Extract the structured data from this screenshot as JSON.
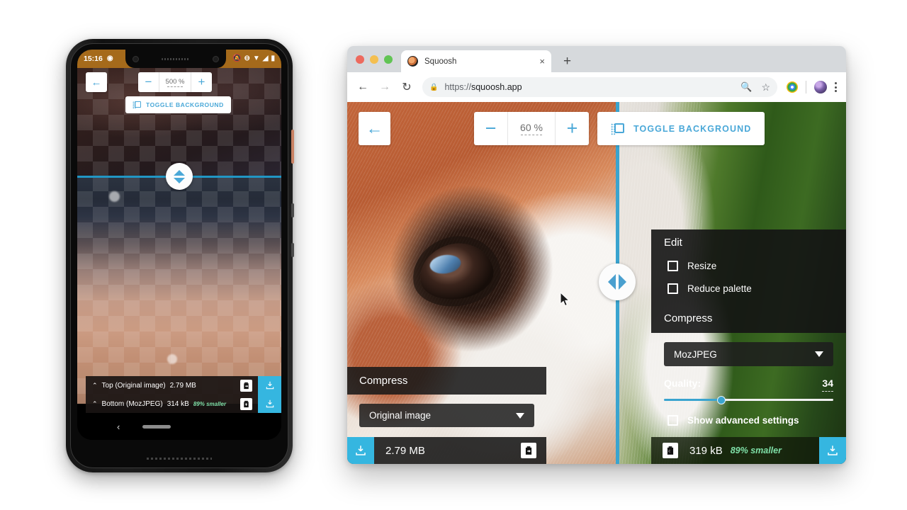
{
  "phone": {
    "status_bar": {
      "time": "15:16",
      "left_icon": "pocket-casts-icon",
      "right_icons": [
        "notifications-muted-icon",
        "do-not-disturb-icon",
        "wifi-icon",
        "cellular-signal-icon",
        "battery-icon"
      ]
    },
    "toolbar": {
      "back_label": "←",
      "zoom_minus": "−",
      "zoom_value": "500 %",
      "zoom_plus": "+",
      "toggle_background_label": "TOGGLE BACKGROUND"
    },
    "bars": [
      {
        "caret": "⌃",
        "label": "Top (Original image)",
        "size": "2.79 MB",
        "smaller": "",
        "copy_icon": "copy-to-other-side-icon",
        "download_icon": "download-icon"
      },
      {
        "caret": "⌃",
        "label": "Bottom (MozJPEG)",
        "size": "314 kB",
        "smaller": "89% smaller",
        "copy_icon": "copy-to-other-side-icon",
        "download_icon": "download-icon"
      }
    ],
    "nav": {
      "back": "‹",
      "home_pill": ""
    }
  },
  "browser": {
    "window_controls": [
      "close",
      "minimize",
      "zoom"
    ],
    "tab": {
      "title": "Squoosh",
      "close": "×",
      "favicon": "squoosh-favicon"
    },
    "new_tab": "+",
    "omnibox": {
      "back": "←",
      "forward": "→",
      "reload": "↻",
      "lock_icon": "lock-icon",
      "url_scheme": "https://",
      "url_host": "squoosh.app",
      "search_icon": "search-icon",
      "bookmark_icon": "star-icon",
      "extension_icon": "chrome-extension-icon",
      "profile_icon": "profile-avatar",
      "menu_icon": "kebab-menu-icon"
    }
  },
  "app": {
    "toolbar": {
      "back_label": "←",
      "zoom_minus": "−",
      "zoom_value": "60 %",
      "zoom_plus": "+",
      "toggle_background_label": "TOGGLE BACKGROUND"
    },
    "edit_panel": {
      "title": "Edit",
      "options": [
        "Resize",
        "Reduce palette"
      ],
      "compress_title": "Compress",
      "codec_selected": "MozJPEG",
      "quality_label": "Quality:",
      "quality_value": "34",
      "quality_percent": 34,
      "advanced_label": "Show advanced settings"
    },
    "compress_panel": {
      "title": "Compress",
      "codec_selected": "Original image"
    },
    "bottom_left": {
      "download_icon": "download-icon",
      "size": "2.79 MB",
      "copy_icon": "copy-to-other-side-icon"
    },
    "bottom_right": {
      "copy_icon": "copy-to-other-side-icon",
      "size": "319 kB",
      "smaller": "89% smaller",
      "download_icon": "download-icon"
    },
    "split_handle_icon": "split-drag-handle-icon"
  },
  "colors": {
    "accent": "#4aa8d8",
    "divider": "#3aa4cf",
    "download_button": "#35b6e0",
    "smaller_text": "#7fe0a8",
    "phone_status_bar": "#a56a1b"
  }
}
